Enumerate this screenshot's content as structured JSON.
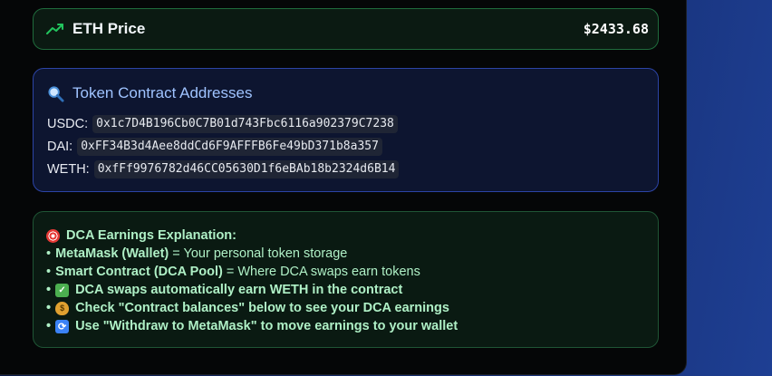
{
  "price_card": {
    "title": "ETH Price",
    "value": "$2433.68",
    "icon": "trending-up-icon",
    "accent": "#22c55e"
  },
  "token_card": {
    "title": "Token Contract Addresses",
    "icon": "magnifier-icon",
    "rows": [
      {
        "label": "USDC:",
        "address": "0x1c7D4B196Cb0C7B01d743Fbc6116a902379C7238"
      },
      {
        "label": "DAI:",
        "address": "0xFF34B3d4Aee8ddCd6F9AFFFB6Fe49bD371b8a357"
      },
      {
        "label": "WETH:",
        "address": "0xfFf9976782d46CC05630D1f6eBAb18b2324d6B14"
      }
    ]
  },
  "dca_card": {
    "title": "DCA Earnings Explanation:",
    "title_icon": "target-icon",
    "items": [
      {
        "bullet": "•",
        "strong": "MetaMask (Wallet)",
        "text": " = Your personal token storage"
      },
      {
        "bullet": "•",
        "strong": "Smart Contract (DCA Pool)",
        "text": " = Where DCA swaps earn tokens"
      },
      {
        "bullet": "•",
        "icon": "check-mark-icon",
        "strong": "DCA swaps automatically earn WETH in the contract"
      },
      {
        "bullet": "•",
        "icon": "money-bag-icon",
        "strong": "Check \"Contract balances\" below to see your DCA earnings"
      },
      {
        "bullet": "•",
        "icon": "refresh-icon",
        "strong": "Use \"Withdraw to MetaMask\" to move earnings to your wallet"
      }
    ]
  }
}
